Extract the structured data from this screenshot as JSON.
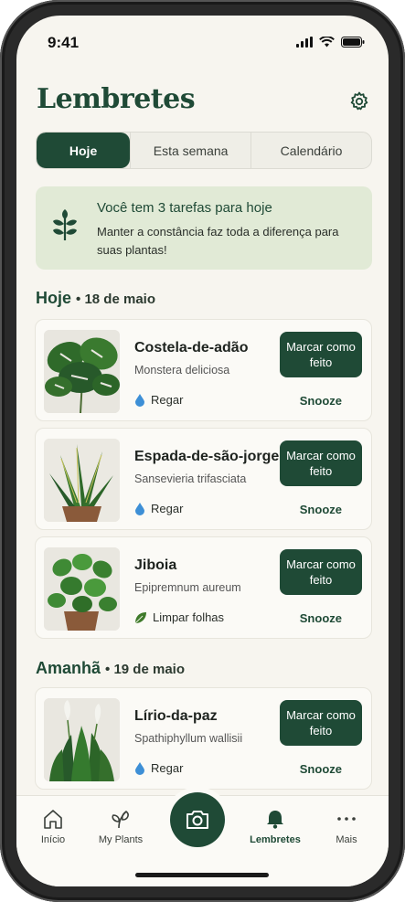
{
  "status": {
    "time": "9:41",
    "icons": [
      "signal-icon",
      "wifi-icon",
      "battery-icon"
    ]
  },
  "header": {
    "title": "Lembretes",
    "settings_icon": "gear-icon"
  },
  "tabs": [
    {
      "label": "Hoje",
      "active": true
    },
    {
      "label": "Esta semana",
      "active": false
    },
    {
      "label": "Calendário",
      "active": false
    }
  ],
  "banner": {
    "icon": "plant-icon",
    "title": "Você tem 3 tarefas para hoje",
    "text": "Manter a constância faz toda a diferença para suas plantas!"
  },
  "sections": [
    {
      "title": "Hoje",
      "date": "18 de maio"
    },
    {
      "title": "Amanhã",
      "date": "19 de maio"
    }
  ],
  "reminders": [
    {
      "name": "Costela-de-adão",
      "scientific": "Monstera deliciosa",
      "task": "Regar",
      "task_icon": "water-drop-icon",
      "button": "Marcar como feito",
      "snooze": "Snooze"
    },
    {
      "name": "Espada-de-são-jorge",
      "scientific": "Sansevieria trifasciata",
      "task": "Regar",
      "task_icon": "water-drop-icon",
      "button": "Marcar como feito",
      "snooze": "Snooze"
    },
    {
      "name": "Jiboia",
      "scientific": "Epipremnum aureum",
      "task": "Limpar folhas",
      "task_icon": "leaf-icon",
      "button": "Marcar como feito",
      "snooze": "Snooze"
    },
    {
      "name": "Lírio-da-paz",
      "scientific": "Spathiphyllum wallisii",
      "task": "Regar",
      "task_icon": "water-drop-icon",
      "button": "Marcar como feito",
      "snooze": "Snooze"
    }
  ],
  "nav": [
    {
      "label": "Início",
      "icon": "home-icon"
    },
    {
      "label": "My Plants",
      "icon": "plant-icon"
    },
    {
      "label": "",
      "icon": "camera-icon"
    },
    {
      "label": "Lembretes",
      "icon": "bell-icon",
      "active": true
    },
    {
      "label": "Mais",
      "icon": "more-icon"
    }
  ],
  "colors": {
    "primary": "#1f4a36",
    "background": "#f7f5ef",
    "banner": "#e1ead6",
    "accent_water": "#3d8fd6",
    "accent_leaf": "#3e7a2a"
  }
}
